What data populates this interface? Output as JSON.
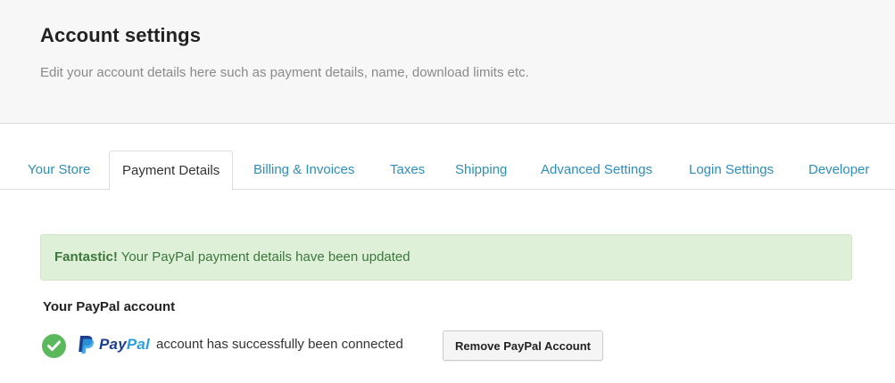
{
  "header": {
    "title": "Account settings",
    "subtitle": "Edit your account details here such as payment details, name, download limits etc."
  },
  "tabs": [
    {
      "label": "Your Store",
      "active": false
    },
    {
      "label": "Payment Details",
      "active": true
    },
    {
      "label": "Billing & Invoices",
      "active": false
    },
    {
      "label": "Taxes",
      "active": false
    },
    {
      "label": "Shipping",
      "active": false
    },
    {
      "label": "Advanced Settings",
      "active": false
    },
    {
      "label": "Login Settings",
      "active": false
    },
    {
      "label": "Developer",
      "active": false
    }
  ],
  "alert": {
    "strong": "Fantastic!",
    "message": " Your PayPal payment details have been updated"
  },
  "paypal_section": {
    "heading": "Your PayPal account",
    "logo_text_pay": "Pay",
    "logo_text_pal": "Pal",
    "status_text": "account has successfully been connected",
    "remove_button_label": "Remove PayPal Account",
    "icons": {
      "status": "check-circle-icon",
      "logo": "paypal-logo"
    }
  },
  "colors": {
    "tab_link": "#2a8fbd",
    "alert_bg": "#dff0d8",
    "alert_text": "#3c763d",
    "success_icon": "#5cb85c",
    "paypal_dark": "#1b3f8f",
    "paypal_light": "#2a9fe0"
  }
}
